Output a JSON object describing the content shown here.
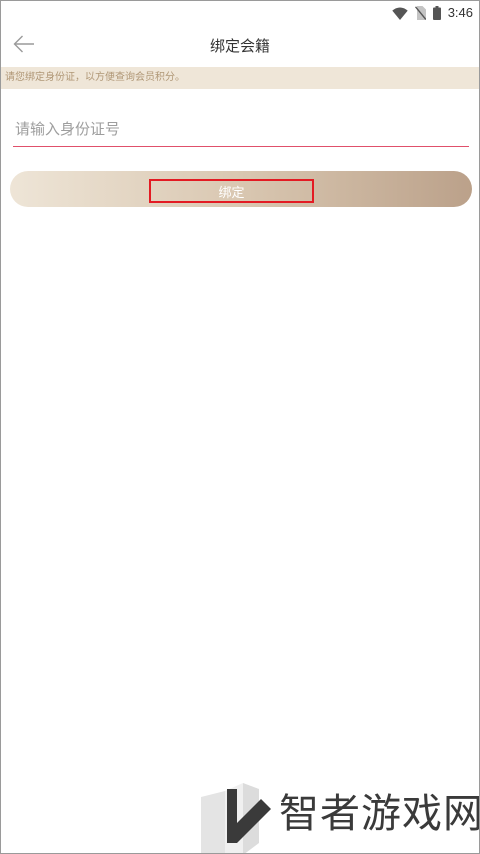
{
  "status_bar": {
    "time": "3:46",
    "icons": [
      "wifi-icon",
      "no-sim-icon",
      "battery-icon"
    ]
  },
  "header": {
    "title": "绑定会籍",
    "back_icon": "arrow-left-icon"
  },
  "notice": {
    "text": "请您绑定身份证，以方便查询会员积分。"
  },
  "form": {
    "id_input": {
      "value": "",
      "placeholder": "请输入身份证号"
    },
    "bind_button_label": "绑定"
  },
  "watermark": {
    "text": "智者游戏网"
  },
  "colors": {
    "notice_bg": "#efe6d8",
    "notice_text": "#b09776",
    "input_underline": "#e0506b",
    "button_gradient_start": "#eee5d7",
    "button_gradient_end": "#bba18a",
    "highlight_box": "#e31b23"
  }
}
